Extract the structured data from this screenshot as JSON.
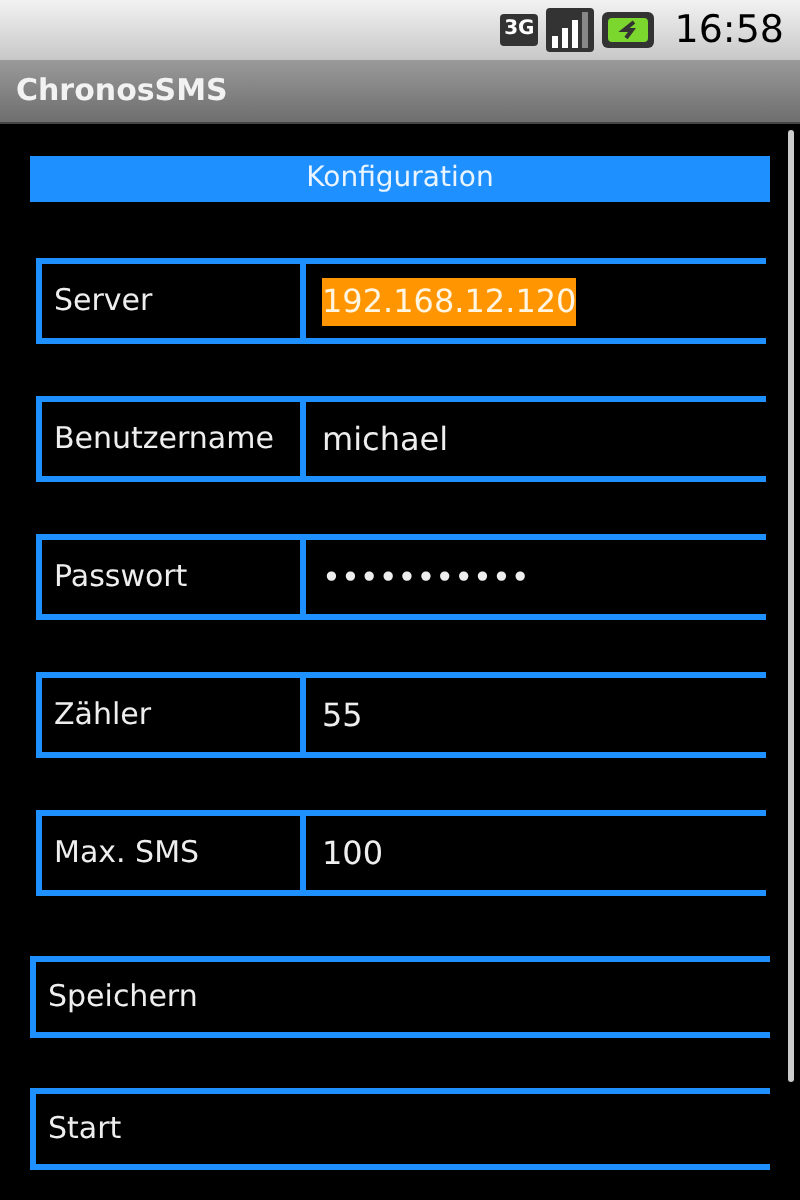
{
  "status_bar": {
    "time": "16:58",
    "network": "3G"
  },
  "window": {
    "title": "ChronosSMS"
  },
  "section_header": "Konfiguration",
  "fields": [
    {
      "label": "Server",
      "value": "192.168.12.120",
      "selected": true
    },
    {
      "label": "Benutzername",
      "value": "michael",
      "selected": false
    },
    {
      "label": "Passwort",
      "value": "•••••••••••",
      "selected": false
    },
    {
      "label": "Zähler",
      "value": "55",
      "selected": false
    },
    {
      "label": "Max. SMS",
      "value": "100",
      "selected": false
    }
  ],
  "buttons": [
    "Speichern",
    "Start"
  ]
}
